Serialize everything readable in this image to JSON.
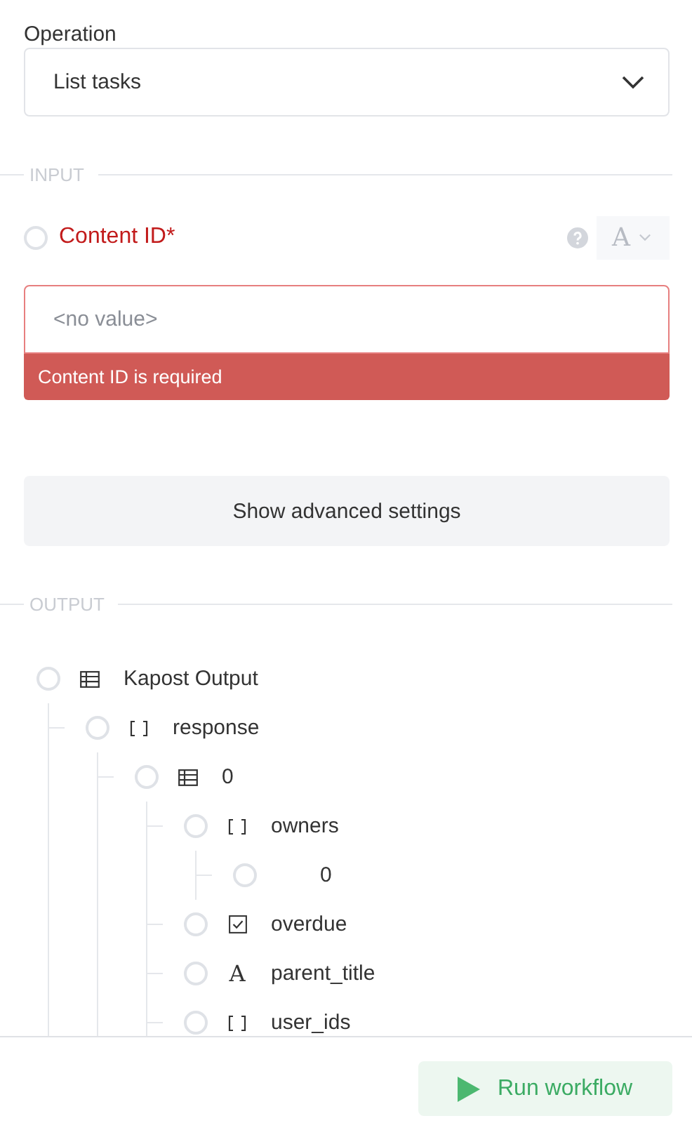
{
  "operation": {
    "label": "Operation",
    "value": "List tasks"
  },
  "input": {
    "heading": "INPUT",
    "field": {
      "label": "Content ID*",
      "selected": false,
      "required_error": true,
      "placeholder": "<no value>",
      "error": "Content ID is required",
      "type_letter": "A"
    }
  },
  "advanced_button": "Show advanced settings",
  "output": {
    "heading": "OUTPUT",
    "tree": [
      {
        "label": "Kapost Output",
        "kind": "table",
        "selected": false,
        "children": [
          {
            "label": "response",
            "kind": "array",
            "selected": false,
            "children": [
              {
                "label": "0",
                "kind": "table",
                "selected": false,
                "children": [
                  {
                    "label": "owners",
                    "kind": "array",
                    "selected": false,
                    "children": [
                      {
                        "label": "0",
                        "selected": false
                      }
                    ]
                  },
                  {
                    "label": "overdue",
                    "kind": "boolean",
                    "selected": false
                  },
                  {
                    "label": "parent_title",
                    "kind": "text",
                    "type_letter": "A",
                    "selected": false
                  },
                  {
                    "label": "user_ids",
                    "kind": "array",
                    "selected": false
                  }
                ]
              }
            ]
          }
        ]
      }
    ]
  },
  "run_button": "Run workflow"
}
